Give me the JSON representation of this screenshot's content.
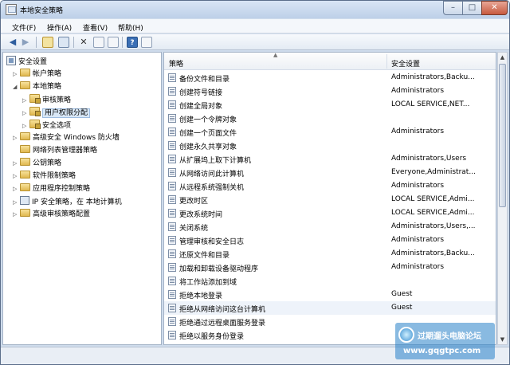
{
  "window": {
    "title": "本地安全策略",
    "minimize_glyph": "–",
    "maximize_glyph": "□",
    "close_glyph": "✕"
  },
  "menu": {
    "items": [
      {
        "label": "文件(F)"
      },
      {
        "label": "操作(A)"
      },
      {
        "label": "查看(V)"
      },
      {
        "label": "帮助(H)"
      }
    ]
  },
  "toolbar": {
    "icons": [
      "back-arrow-icon",
      "forward-arrow-icon",
      "up-folder-icon",
      "show-tree-icon",
      "delete-icon",
      "properties-icon",
      "export-list-icon",
      "help-icon",
      "help-topic-icon"
    ]
  },
  "tree": {
    "root": {
      "label": "安全设置"
    },
    "items": [
      {
        "label": "帐户策略",
        "expanded": false
      },
      {
        "label": "本地策略",
        "expanded": true
      },
      {
        "label": "审核策略",
        "expanded": false
      },
      {
        "label": "用户权限分配",
        "selected": true
      },
      {
        "label": "安全选项",
        "expanded": false
      },
      {
        "label": "高级安全 Windows 防火墙",
        "expanded": false
      },
      {
        "label": "网络列表管理器策略"
      },
      {
        "label": "公钥策略",
        "expanded": false
      },
      {
        "label": "软件限制策略",
        "expanded": false
      },
      {
        "label": "应用程序控制策略",
        "expanded": false
      },
      {
        "label": "IP 安全策略，在 本地计算机"
      },
      {
        "label": "高级审核策略配置",
        "expanded": false
      }
    ]
  },
  "list": {
    "columns": {
      "policy": "策略",
      "setting": "安全设置"
    },
    "rows": [
      {
        "policy": "备份文件和目录",
        "setting": "Administrators,Backu..."
      },
      {
        "policy": "创建符号链接",
        "setting": "Administrators"
      },
      {
        "policy": "创建全局对象",
        "setting": "LOCAL SERVICE,NET..."
      },
      {
        "policy": "创建一个令牌对象",
        "setting": ""
      },
      {
        "policy": "创建一个页面文件",
        "setting": "Administrators"
      },
      {
        "policy": "创建永久共享对象",
        "setting": ""
      },
      {
        "policy": "从扩展坞上取下计算机",
        "setting": "Administrators,Users"
      },
      {
        "policy": "从网络访问此计算机",
        "setting": "Everyone,Administrat..."
      },
      {
        "policy": "从远程系统强制关机",
        "setting": "Administrators"
      },
      {
        "policy": "更改时区",
        "setting": "LOCAL SERVICE,Admi..."
      },
      {
        "policy": "更改系统时间",
        "setting": "LOCAL SERVICE,Admi..."
      },
      {
        "policy": "关闭系统",
        "setting": "Administrators,Users,..."
      },
      {
        "policy": "管理审核和安全日志",
        "setting": "Administrators"
      },
      {
        "policy": "还原文件和目录",
        "setting": "Administrators,Backu..."
      },
      {
        "policy": "加载和卸载设备驱动程序",
        "setting": "Administrators"
      },
      {
        "policy": "将工作站添加到域",
        "setting": ""
      },
      {
        "policy": "拒绝本地登录",
        "setting": "Guest"
      },
      {
        "policy": "拒绝从网络访问这台计算机",
        "setting": "Guest",
        "highlight": true
      },
      {
        "policy": "拒绝通过远程桌面服务登录",
        "setting": ""
      },
      {
        "policy": "拒绝以服务身份登录",
        "setting": ""
      },
      {
        "policy": "拒绝作为批处理作业登录",
        "setting": ""
      }
    ]
  },
  "watermark": {
    "text": "过期遛头电脑论坛",
    "url": "www.gqgtpc.com"
  }
}
